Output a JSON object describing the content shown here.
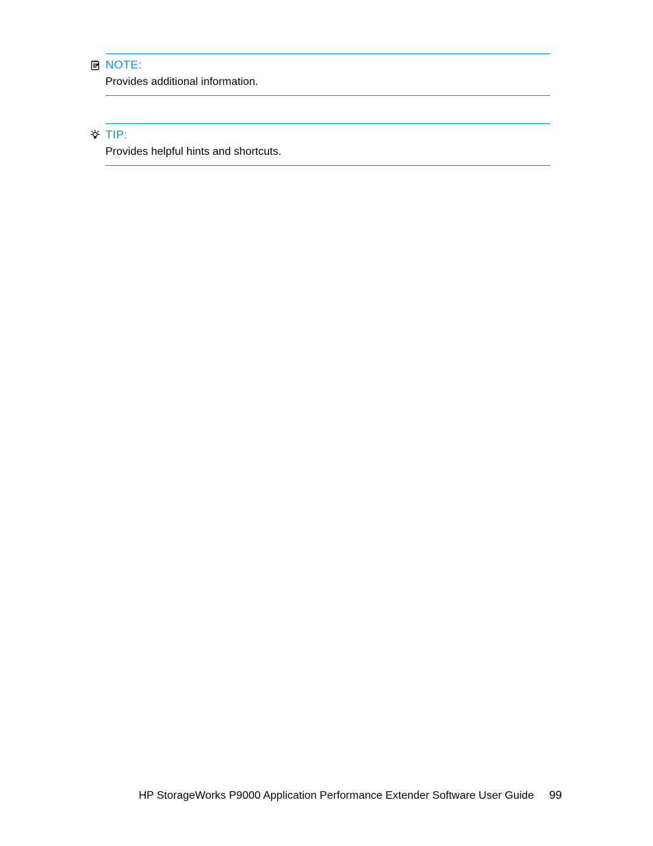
{
  "callouts": {
    "note": {
      "title": "NOTE:",
      "body": "Provides additional information."
    },
    "tip": {
      "title": "TIP:",
      "body": "Provides helpful hints and shortcuts."
    }
  },
  "footer": {
    "title": "HP StorageWorks P9000 Application Performance Extender Software User Guide",
    "page": "99"
  },
  "colors": {
    "accent": "#0096d6"
  }
}
